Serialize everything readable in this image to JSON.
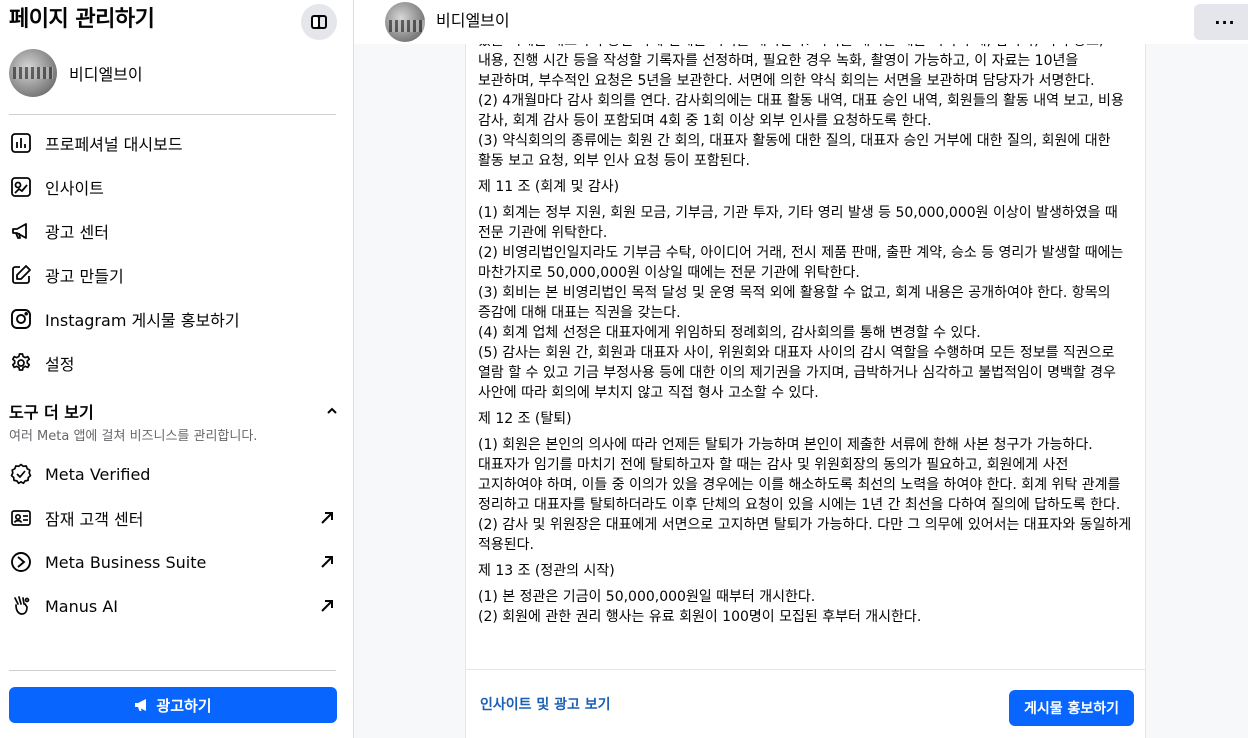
{
  "sidebar": {
    "title": "페이지 관리하기",
    "page_name": "비디엘브이",
    "menu": [
      {
        "label": "프로페셔널 대시보드",
        "icon": "dashboard-icon"
      },
      {
        "label": "인사이트",
        "icon": "insights-icon"
      },
      {
        "label": "광고 센터",
        "icon": "megaphone-icon"
      },
      {
        "label": "광고 만들기",
        "icon": "edit-icon"
      },
      {
        "label": "Instagram 게시물 홍보하기",
        "icon": "instagram-icon"
      },
      {
        "label": "설정",
        "icon": "gear-icon"
      }
    ],
    "tools": {
      "title": "도구 더 보기",
      "subtitle": "여러 Meta 앱에 걸쳐 비즈니스를 관리합니다.",
      "items": [
        {
          "label": "Meta Verified",
          "icon": "verified-badge-icon",
          "external": false
        },
        {
          "label": "잠재 고객 센터",
          "icon": "contact-card-icon",
          "external": true
        },
        {
          "label": "Meta Business Suite",
          "icon": "business-suite-icon",
          "external": true
        },
        {
          "label": "Manus AI",
          "icon": "manus-icon",
          "external": true
        }
      ]
    },
    "ad_button": "광고하기"
  },
  "header": {
    "page_name": "비디엘브이",
    "more_label": "···"
  },
  "post": {
    "paragraphs": [
      "있을 시에는 대표자의 승인 하에 언제든 회의를 개시한다. 회의를 개시할 때는 회의 주제, 참가자, 회의 장소, 내용, 진행 시간 등을 작성할 기록자를 선정하며, 필요한 경우 녹화, 촬영이 가능하고, 이 자료는 10년을 보관하며, 부수적인 요청은 5년을 보관한다. 서면에 의한 약식 회의는 서면을 보관하며 담당자가 서명한다.",
      "(2) 4개월마다 감사 회의를 연다. 감사회의에는 대표 활동 내역, 대표 승인 내역, 회원들의 활동 내역 보고, 비용 감사, 회계 감사 등이 포함되며 4회 중 1회 이상 외부 인사를 요청하도록 한다.",
      "(3) 약식회의의 종류에는 회원 간 회의, 대표자 활동에 대한 질의, 대표자 승인 거부에 대한 질의, 회원에 대한 활동 보고 요청, 외부 인사 요청 등이 포함된다.",
      "제 11 조 (회계 및 감사)",
      "(1) 회계는 정부 지원, 회원 모금, 기부금, 기관 투자, 기타 영리 발생 등 50,000,000원 이상이 발생하였을 때 전문 기관에 위탁한다.",
      "(2) 비영리법인일지라도 기부금 수탁, 아이디어 거래, 전시 제품 판매, 출판 계약, 승소 등 영리가 발생할 때에는 마찬가지로 50,000,000원 이상일 때에는 전문 기관에 위탁한다.",
      "(3) 회비는 본 비영리법인 목적 달성 및 운영 목적 외에 활용할 수 없고, 회계 내용은 공개하여야 한다. 항목의 증감에 대해 대표는 직권을 갖는다.",
      "(4) 회계 업체 선정은 대표자에게 위임하되 정례회의, 감사회의를 통해 변경할 수 있다.",
      "(5) 감사는 회원 간, 회원과 대표자 사이, 위원회와 대표자 사이의 감시 역할을 수행하며 모든 정보를 직권으로 열람 할 수 있고 기금 부정사용 등에 대한 이의 제기권을 가지며, 급박하거나 심각하고 불법적임이 명백할 경우 사안에 따라 회의에 부치지 않고 직접 형사 고소할 수 있다.",
      "제 12 조 (탈퇴)",
      "(1) 회원은 본인의 의사에 따라 언제든 탈퇴가 가능하며 본인이 제출한 서류에 한해 사본 청구가 가능하다. 대표자가 임기를 마치기 전에 탈퇴하고자 할 때는 감사 및 위원회장의 동의가 필요하고, 회원에게 사전 고지하여야 하며, 이들 중 이의가 있을 경우에는 이를 해소하도록 최선의 노력을 하여야 한다. 회계 위탁 관계를 정리하고 대표자를 탈퇴하더라도 이후 단체의 요청이 있을 시에는 1년 간 최선을 다하여 질의에 답하도록 한다.",
      "(2) 감사 및 위원장은 대표에게 서면으로 고지하면 탈퇴가 가능하다. 다만 그 의무에 있어서는 대표자와 동일하게 적용된다.",
      "제 13 조 (정관의 시작)",
      "(1) 본 정관은 기금이 50,000,000원일 때부터 개시한다.",
      "(2) 회원에 관한 권리 행사는 유료 회원이 100명이 모집된 후부터 개시한다."
    ],
    "footer": {
      "insights_link": "인사이트 및 광고 보기",
      "boost_button": "게시물 홍보하기"
    }
  },
  "colors": {
    "accent": "#0866ff",
    "link": "#1b5fb5",
    "muted": "#65676b"
  }
}
